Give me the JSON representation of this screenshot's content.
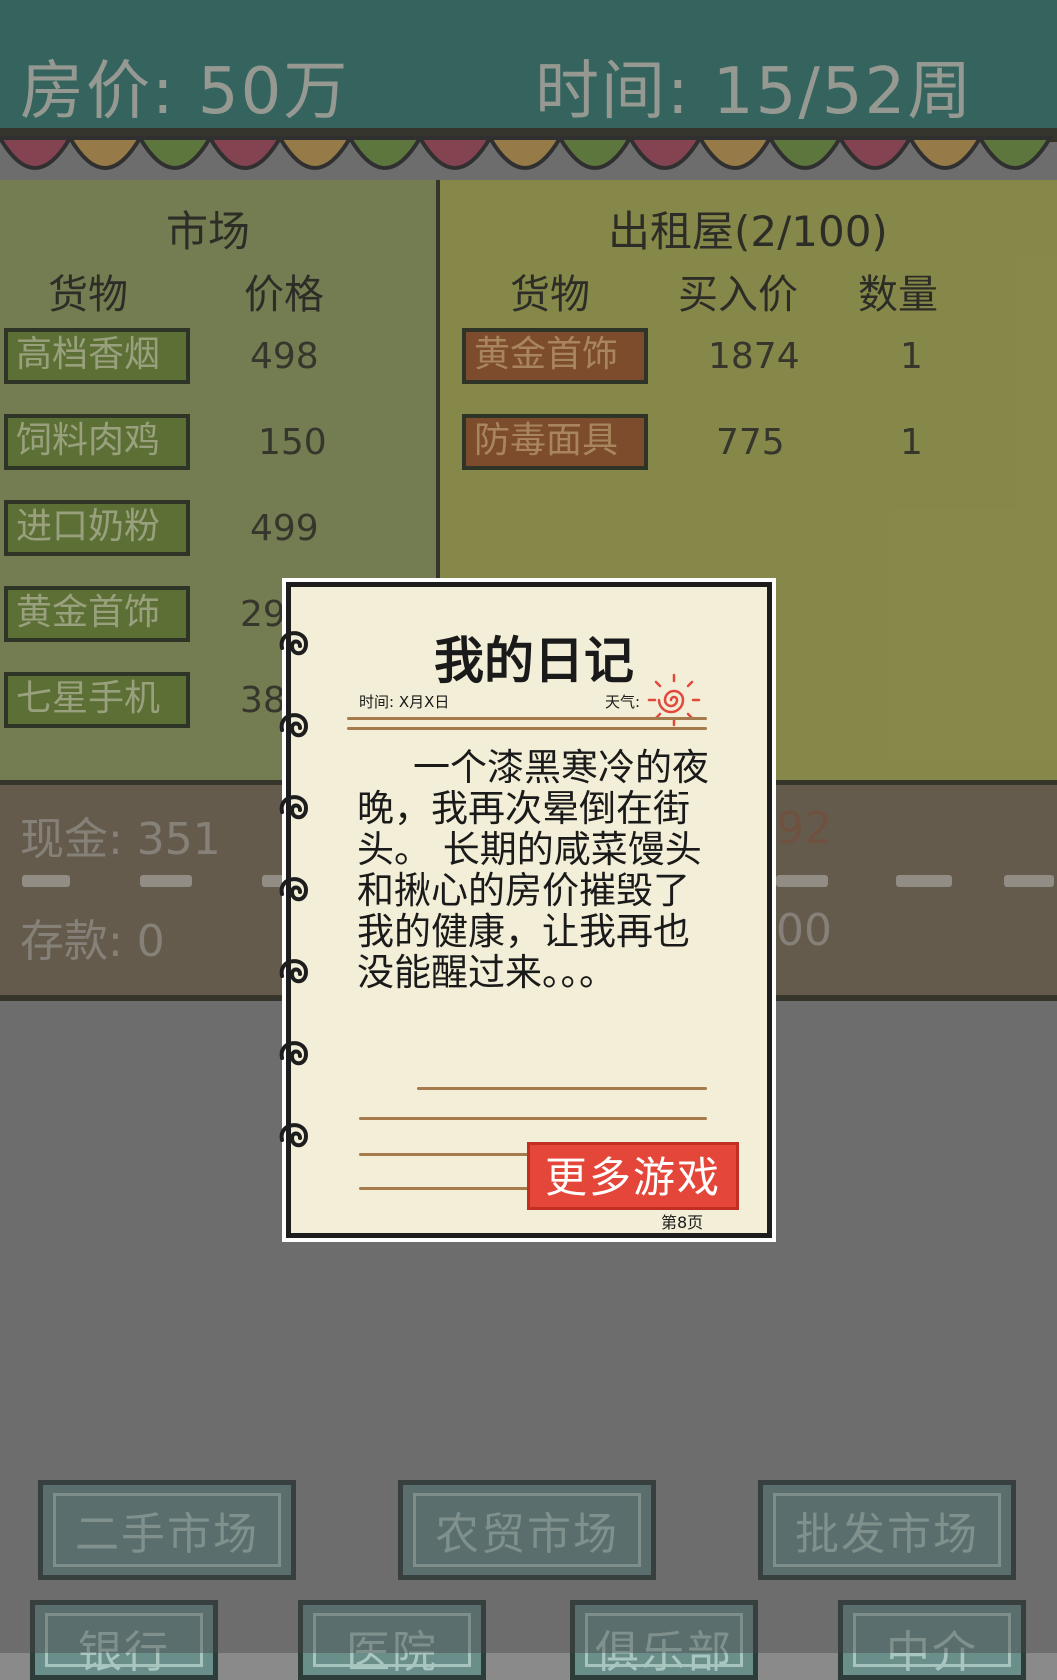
{
  "header": {
    "house_price": "房价: 50万",
    "time": "时间: 15/52周"
  },
  "market": {
    "title": "市场",
    "col_goods": "货物",
    "col_price": "价格",
    "items": [
      {
        "name": "高档香烟",
        "price": "498"
      },
      {
        "name": "饲料肉鸡",
        "price": "150"
      },
      {
        "name": "进口奶粉",
        "price": "499"
      },
      {
        "name": "黄金首饰",
        "price": "29"
      },
      {
        "name": "七星手机",
        "price": "38"
      }
    ]
  },
  "rental": {
    "title": "出租屋(2/100)",
    "col_goods": "货物",
    "col_buy_price": "买入价",
    "col_qty": "数量",
    "items": [
      {
        "name": "黄金首饰",
        "buy_price": "1874",
        "qty": "1"
      },
      {
        "name": "防毒面具",
        "buy_price": "775",
        "qty": "1"
      }
    ]
  },
  "stats": {
    "cash": "现金: 351",
    "deposit": "存款: 0",
    "right_top": "92",
    "right_bottom": "00"
  },
  "nav": {
    "row1": [
      "二手市场",
      "农贸市场",
      "批发市场"
    ],
    "row2": [
      "银行",
      "医院",
      "俱乐部",
      "中介"
    ]
  },
  "diary": {
    "title": "我的日记",
    "date_label": "时间: X月X日",
    "weather_label": "天气:",
    "body": "一个漆黑寒冷的夜晚，我再次晕倒在街头。 长期的咸菜馒头和揪心的房价摧毁了我的健康，让我再也没能醒过来。。。",
    "more_games": "更多游戏",
    "page": "第8页"
  },
  "colors": {
    "header": "#2a7a73",
    "market_panel": "#97a55a",
    "rental_panel": "#b6b94c",
    "green_button": "#6d8e2a",
    "brown_button": "#a4521d",
    "diary_paper": "#f2eed7",
    "more_games_button": "#e5463a"
  },
  "icons": [
    "sun-icon",
    "spiral-ring-icon"
  ]
}
